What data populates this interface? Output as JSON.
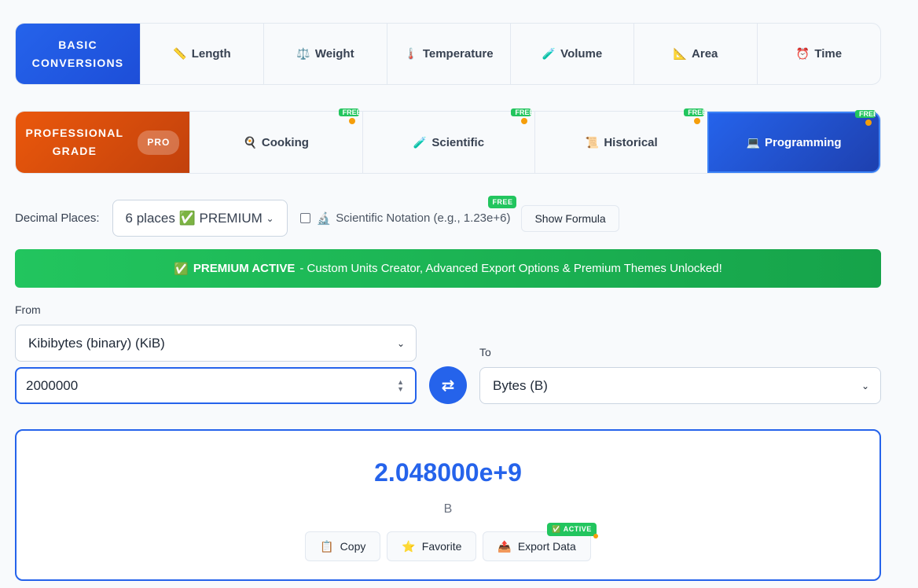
{
  "basic": {
    "label_line1": "BASIC",
    "label_line2": "CONVERSIONS",
    "tabs": [
      {
        "icon": "📏",
        "label": "Length"
      },
      {
        "icon": "⚖️",
        "label": "Weight"
      },
      {
        "icon": "🌡️",
        "label": "Temperature"
      },
      {
        "icon": "🧪",
        "label": "Volume"
      },
      {
        "icon": "📐",
        "label": "Area"
      },
      {
        "icon": "⏰",
        "label": "Time"
      }
    ]
  },
  "professional": {
    "label_line1": "PROFESSIONAL",
    "label_line2": "GRADE",
    "badge": "PRO",
    "tabs": [
      {
        "icon": "🍳",
        "label": "Cooking",
        "corner": "FREE"
      },
      {
        "icon": "🧪",
        "label": "Scientific",
        "corner": "FREE"
      },
      {
        "icon": "📜",
        "label": "Historical",
        "corner": "FREE"
      },
      {
        "icon": "💻",
        "label": "Programming",
        "corner": "FREE",
        "active": true
      }
    ]
  },
  "options": {
    "decimal_label": "Decimal Places:",
    "decimal_value": "6 places ✅ PREMIUM",
    "sci_icon": "🔬",
    "sci_label": "Scientific Notation (e.g., 1.23e+6)",
    "free_badge": "FREE",
    "formula_button": "Show Formula"
  },
  "banner": {
    "icon": "✅",
    "strong": "PREMIUM ACTIVE",
    "text": "- Custom Units Creator, Advanced Export Options & Premium Themes Unlocked!"
  },
  "from": {
    "label": "From",
    "unit": "Kibibytes (binary) (KiB)",
    "value": "2000000"
  },
  "to": {
    "label": "To",
    "unit": "Bytes (B)"
  },
  "swap_icon": "⇄",
  "result": {
    "value": "2.048000e+9",
    "unit": "B",
    "actions": {
      "copy": {
        "icon": "📋",
        "label": "Copy"
      },
      "favorite": {
        "icon": "⭐",
        "label": "Favorite"
      },
      "export": {
        "icon": "📤",
        "label": "Export Data",
        "badge": "✅ ACTIVE"
      }
    }
  },
  "colors": {
    "primary": "#2563eb",
    "pro": "#ea580c",
    "success": "#22c55e"
  }
}
